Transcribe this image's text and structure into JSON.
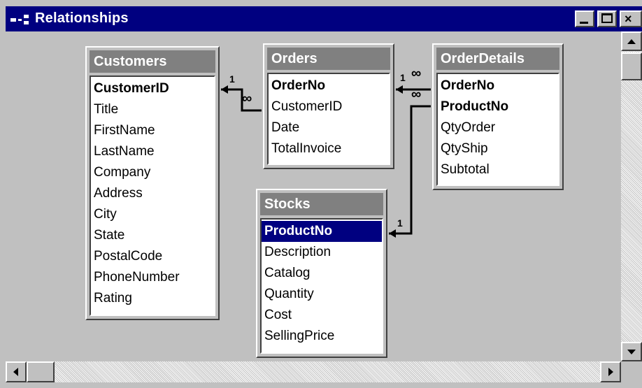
{
  "window": {
    "title": "Relationships"
  },
  "tables": {
    "customers": {
      "title": "Customers",
      "fields": [
        "CustomerID",
        "Title",
        "FirstName",
        "LastName",
        "Company",
        "Address",
        "City",
        "State",
        "PostalCode",
        "PhoneNumber",
        "Rating"
      ]
    },
    "orders": {
      "title": "Orders",
      "fields": [
        "OrderNo",
        "CustomerID",
        "Date",
        "TotalInvoice"
      ]
    },
    "orderdetails": {
      "title": "OrderDetails",
      "fields": [
        "OrderNo",
        "ProductNo",
        "QtyOrder",
        "QtyShip",
        "Subtotal"
      ]
    },
    "stocks": {
      "title": "Stocks",
      "fields": [
        "ProductNo",
        "Description",
        "Catalog",
        "Quantity",
        "Cost",
        "SellingPrice"
      ]
    }
  },
  "relations": {
    "cust_orders_one": "1",
    "cust_orders_many": "∞",
    "orders_details_one": "1",
    "orders_details_many": "∞",
    "stocks_details_many": "∞",
    "stocks_details_one": "1"
  }
}
